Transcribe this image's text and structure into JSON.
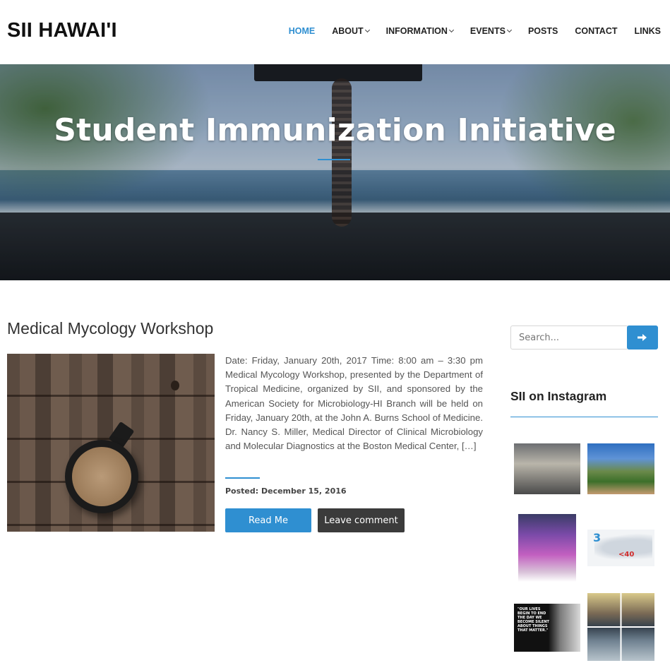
{
  "header": {
    "logo": "SII HAWAI'I",
    "nav": [
      {
        "label": "HOME",
        "active": true,
        "dropdown": false
      },
      {
        "label": "ABOUT",
        "active": false,
        "dropdown": true
      },
      {
        "label": "INFORMATION",
        "active": false,
        "dropdown": true
      },
      {
        "label": "EVENTS",
        "active": false,
        "dropdown": true
      },
      {
        "label": "POSTS",
        "active": false,
        "dropdown": false
      },
      {
        "label": "CONTACT",
        "active": false,
        "dropdown": false
      },
      {
        "label": "LINKS",
        "active": false,
        "dropdown": false
      }
    ]
  },
  "hero": {
    "title": "Student Immunization Initiative"
  },
  "post": {
    "title": "Medical Mycology Workshop",
    "excerpt": "Date: Friday, January 20th, 2017 Time: 8:00 am – 3:30 pm Medical Mycology Workshop, presented by the Department of Tropical Medicine, organized by SII, and sponsored by the American Society for Microbiology-HI Branch will be held on Friday,  January 20th, at the John A. Burns School of Medicine. Dr. Nancy S. Miller, Medical Director of Clinical Microbiology and Molecular Diagnostics at the Boston Medical Center, […]",
    "posted": "Posted: December 15, 2016",
    "read_label": "Read Me",
    "comment_label": "Leave comment"
  },
  "sidebar": {
    "search_placeholder": "Search...",
    "instagram_title": "SII on Instagram",
    "insta4_count": "3",
    "insta4_small": "<40",
    "insta5_quote": "\"OUR LIVES BEGIN TO END THE DAY WE BECOME SILENT ABOUT THINGS THAT MATTER.\""
  },
  "colors": {
    "accent": "#2f8fd1",
    "dark_button": "#3b3b3b"
  }
}
